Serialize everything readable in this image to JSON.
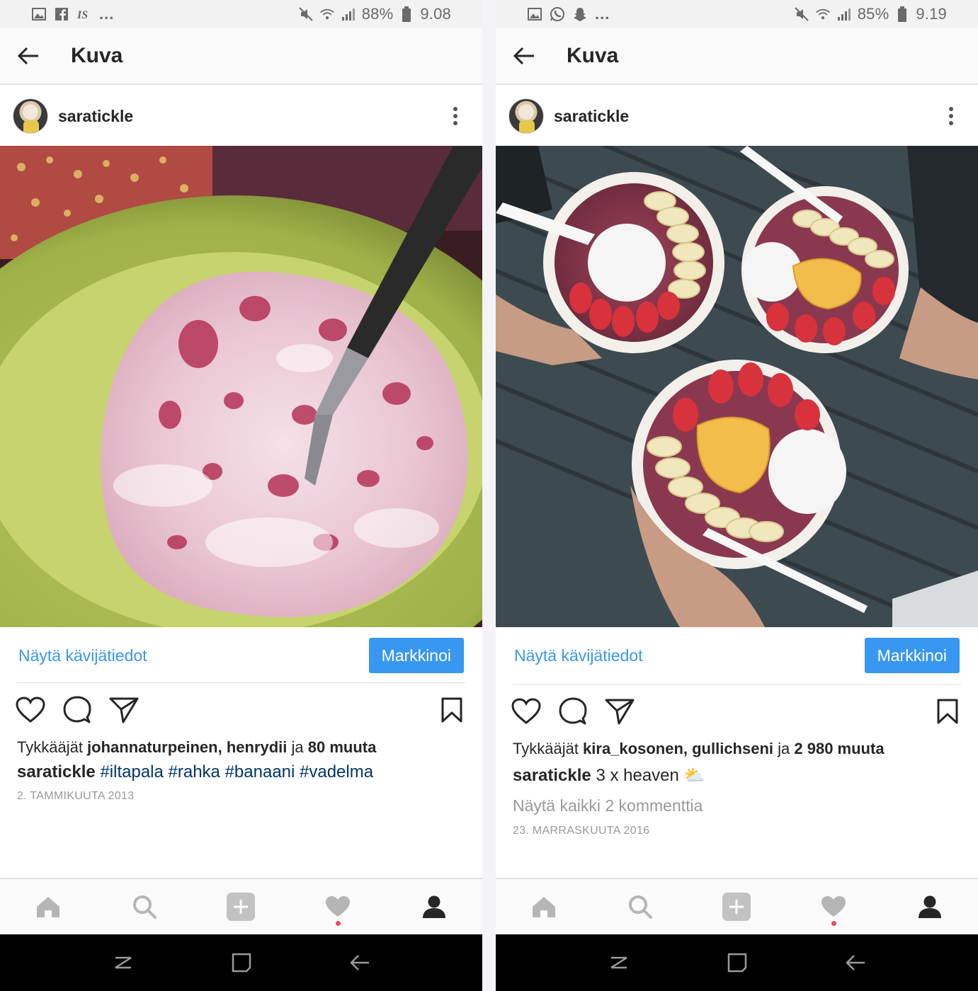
{
  "screens": [
    {
      "status": {
        "battery": "88%",
        "time": "9.08",
        "left_icons": [
          "image-icon",
          "facebook-icon",
          "is-icon"
        ],
        "more": "..."
      },
      "title": "Kuva",
      "username": "saratickle",
      "photo": "Bowl of quark with raspberries and a knife",
      "insights": "Näytä kävijätiedot",
      "promote": "Markkinoi",
      "likes": {
        "prefix": "Tykkääjät ",
        "names": "johannaturpeinen, henrydii",
        "and": " ja ",
        "others": "80 muuta"
      },
      "caption": {
        "user": "saratickle",
        "text": "",
        "tags": [
          "#iltapala",
          "#rahka",
          "#banaani",
          "#vadelma"
        ]
      },
      "comments": "",
      "date": "2. TAMMIKUUTA 2013"
    },
    {
      "status": {
        "battery": "85%",
        "time": "9.19",
        "left_icons": [
          "image-icon",
          "whatsapp-icon",
          "snapchat-icon"
        ],
        "more": "..."
      },
      "title": "Kuva",
      "username": "saratickle",
      "photo": "Three smoothie bowls with banana, coconut, mango and strawberries",
      "insights": "Näytä kävijätiedot",
      "promote": "Markkinoi",
      "likes": {
        "prefix": "Tykkääjät ",
        "names": "kira_kosonen, gullichseni",
        "and": " ja ",
        "others": "2 980 muuta"
      },
      "caption": {
        "user": "saratickle",
        "text": "3 x heaven",
        "emoji": "⛅",
        "tags": []
      },
      "comments": "Näytä kaikki 2 kommenttia",
      "date": "23. MARRASKUUTA 2016"
    }
  ],
  "colors": {
    "link": "#3897f0",
    "hashtag": "#003569",
    "muted": "#999999",
    "notification": "#ed4956"
  }
}
